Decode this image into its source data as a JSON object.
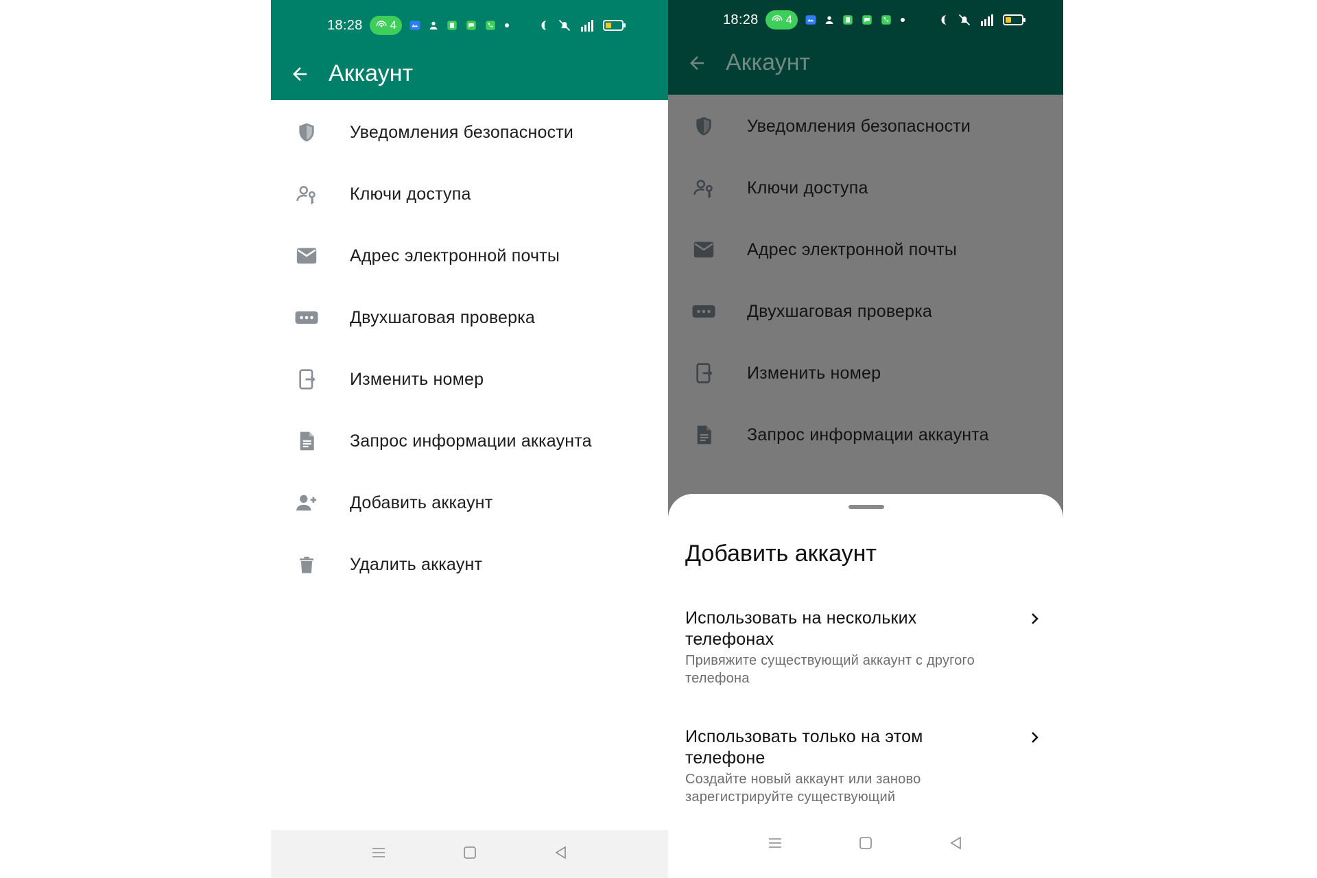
{
  "colors": {
    "accent": "#008069",
    "accent_dark": "#013e33",
    "dim_overlay": "#7a7a7a",
    "icon_gray": "#8a9096",
    "text_primary": "#1d1d1d",
    "text_secondary": "#6e6e6e"
  },
  "status_bar": {
    "time": "18:28",
    "pill_count": "4",
    "network": "4G"
  },
  "screen_left": {
    "title": "Аккаунт",
    "items": [
      {
        "label": "Уведомления безопасности",
        "icon": "shield-icon"
      },
      {
        "label": "Ключи доступа",
        "icon": "passkey-icon"
      },
      {
        "label": "Адрес электронной почты",
        "icon": "email-icon"
      },
      {
        "label": "Двухшаговая проверка",
        "icon": "password-dots-icon"
      },
      {
        "label": "Изменить номер",
        "icon": "change-number-icon"
      },
      {
        "label": "Запрос информации аккаунта",
        "icon": "document-icon"
      },
      {
        "label": "Добавить аккаунт",
        "icon": "add-person-icon"
      },
      {
        "label": "Удалить аккаунт",
        "icon": "trash-icon"
      }
    ]
  },
  "screen_right": {
    "title": "Аккаунт",
    "items": [
      {
        "label": "Уведомления безопасности",
        "icon": "shield-icon"
      },
      {
        "label": "Ключи доступа",
        "icon": "passkey-icon"
      },
      {
        "label": "Адрес электронной почты",
        "icon": "email-icon"
      },
      {
        "label": "Двухшаговая проверка",
        "icon": "password-dots-icon"
      },
      {
        "label": "Изменить номер",
        "icon": "change-number-icon"
      },
      {
        "label": "Запрос информации аккаунта",
        "icon": "document-icon"
      }
    ],
    "sheet": {
      "title": "Добавить аккаунт",
      "options": [
        {
          "title": "Использовать на нескольких телефонах",
          "subtitle": "Привяжите существующий аккаунт с другого телефона"
        },
        {
          "title": "Использовать только на этом телефоне",
          "subtitle": "Создайте новый аккаунт или заново зарегистрируйте существующий"
        }
      ]
    }
  },
  "nav_bar": {
    "buttons": [
      "menu-icon",
      "home-icon",
      "back-triangle-icon"
    ]
  }
}
